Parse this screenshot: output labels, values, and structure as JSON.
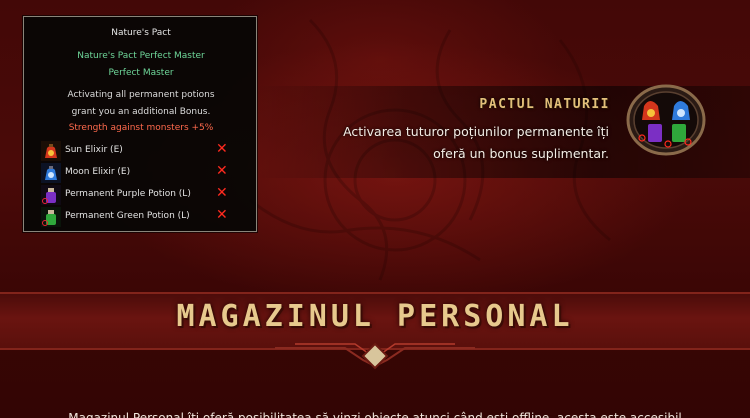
{
  "tooltip": {
    "title": "Nature's Pact",
    "subtitle_1": "Nature's Pact Perfect Master",
    "subtitle_2": "Perfect Master",
    "body_line_1": "Activating all permanent potions",
    "body_line_2": "grant you an additional Bonus.",
    "bonus": "Strength against monsters +5%",
    "items": [
      {
        "name": "Sun Elixir (E)",
        "icon": "sun-elixir-icon",
        "status": "✕"
      },
      {
        "name": "Moon Elixir (E)",
        "icon": "moon-elixir-icon",
        "status": "✕"
      },
      {
        "name": "Permanent Purple Potion (L)",
        "icon": "purple-potion-icon",
        "status": "✕"
      },
      {
        "name": "Permanent Green Potion (L)",
        "icon": "green-potion-icon",
        "status": "✕"
      }
    ]
  },
  "pact": {
    "title": "PACTUL NATURII",
    "desc_line_1": "Activarea tuturor poțiunilor permanente îți",
    "desc_line_2": "oferă un bonus suplimentar."
  },
  "shop": {
    "title": "MAGAZINUL PERSONAL",
    "bottom_text": "Magazinul Personal îți oferă posibilitatea să vinzi obiecte atunci când ești offline, acesta este accesibil"
  },
  "colors": {
    "accent_gold": "#e7c98d",
    "bonus_red": "#ff6a4d",
    "tooltip_green": "#6fd79a",
    "missing_x": "#ff2a1f"
  }
}
